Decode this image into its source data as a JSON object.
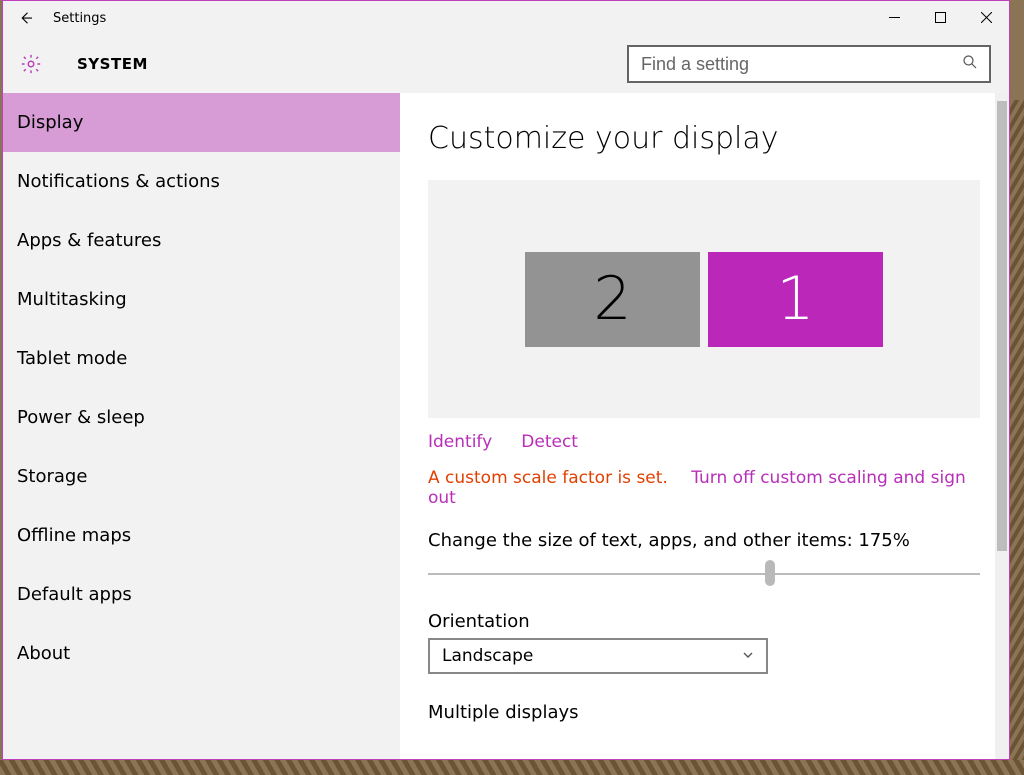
{
  "window": {
    "title": "Settings"
  },
  "header": {
    "section": "SYSTEM"
  },
  "search": {
    "placeholder": "Find a setting"
  },
  "sidebar": {
    "items": [
      "Display",
      "Notifications & actions",
      "Apps & features",
      "Multitasking",
      "Tablet mode",
      "Power & sleep",
      "Storage",
      "Offline maps",
      "Default apps",
      "About"
    ],
    "active_index": 0
  },
  "main": {
    "heading": "Customize your display",
    "monitors": {
      "left": "2",
      "right": "1",
      "selected": "1"
    },
    "links": {
      "identify": "Identify",
      "detect": "Detect"
    },
    "warning": {
      "text": "A custom scale factor is set.",
      "action": "Turn off custom scaling and sign out"
    },
    "scale": {
      "label_prefix": "Change the size of text, apps, and other items: ",
      "value": "175%"
    },
    "orientation": {
      "label": "Orientation",
      "value": "Landscape"
    },
    "multiple_displays": {
      "label": "Multiple displays"
    }
  },
  "colors": {
    "accent": "#ba27b9"
  }
}
